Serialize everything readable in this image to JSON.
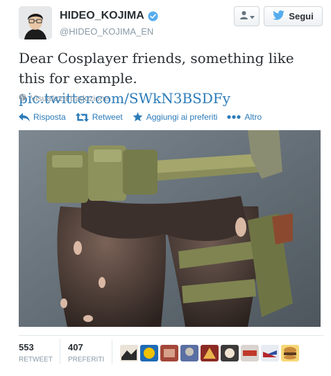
{
  "user": {
    "name": "HIDEO_KOJIMA",
    "handle": "@HIDEO_KOJIMA_EN",
    "verified": true
  },
  "header": {
    "follow_label": "Segui"
  },
  "tweet": {
    "text": "Dear Cosplayer friends, something like this for example.",
    "link": "pic.twitter.com/SWkN3BSDFy",
    "translate_label": "Visualizza traduzione"
  },
  "actions": {
    "reply": "Risposta",
    "retweet": "Retweet",
    "favorite": "Aggiungi ai preferiti",
    "more": "Altro"
  },
  "stats": {
    "retweets_count": "553",
    "retweets_label": "RETWEET",
    "favorites_count": "407",
    "favorites_label": "PREFERITI"
  },
  "colors": {
    "link": "#2b7bb9",
    "muted": "#8899a6",
    "verified": "#55acee"
  },
  "icons": [
    "verified-badge-icon",
    "user-icon",
    "bird-icon",
    "globe-icon",
    "reply-icon",
    "retweet-icon",
    "star-icon",
    "more-dots-icon"
  ]
}
